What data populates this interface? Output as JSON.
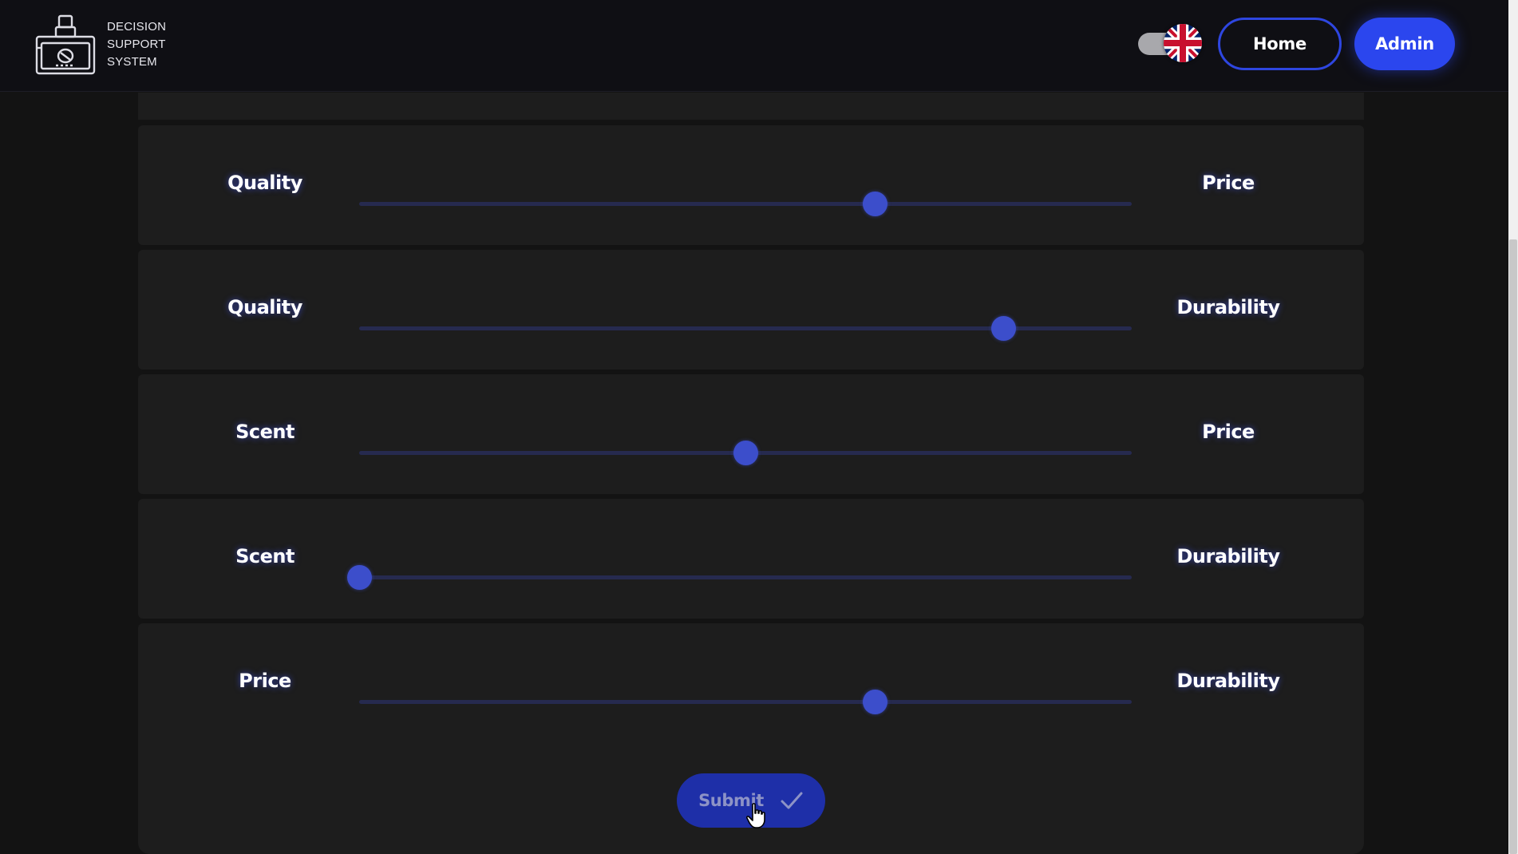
{
  "header": {
    "brand_text": "DECISION\nSUPPORT\nSYSTEM",
    "logo_icon": "perfume-bottle-icon",
    "language_flag": "uk-flag-icon",
    "home_label": "Home",
    "admin_label": "Admin"
  },
  "comparisons": [
    {
      "left": "Quality",
      "right": "Price",
      "value": 0.667
    },
    {
      "left": "Quality",
      "right": "Durability",
      "value": 0.834
    },
    {
      "left": "Scent",
      "right": "Price",
      "value": 0.5
    },
    {
      "left": "Scent",
      "right": "Durability",
      "value": 0.0
    },
    {
      "left": "Price",
      "right": "Durability",
      "value": 0.667
    }
  ],
  "submit": {
    "label": "Submit",
    "icon": "check-icon"
  },
  "colors": {
    "accent": "#2b46ee",
    "slider_thumb": "#3c4ecb",
    "slider_track": "#262a4f",
    "panel": "#1d1d1d",
    "background": "#131313"
  }
}
